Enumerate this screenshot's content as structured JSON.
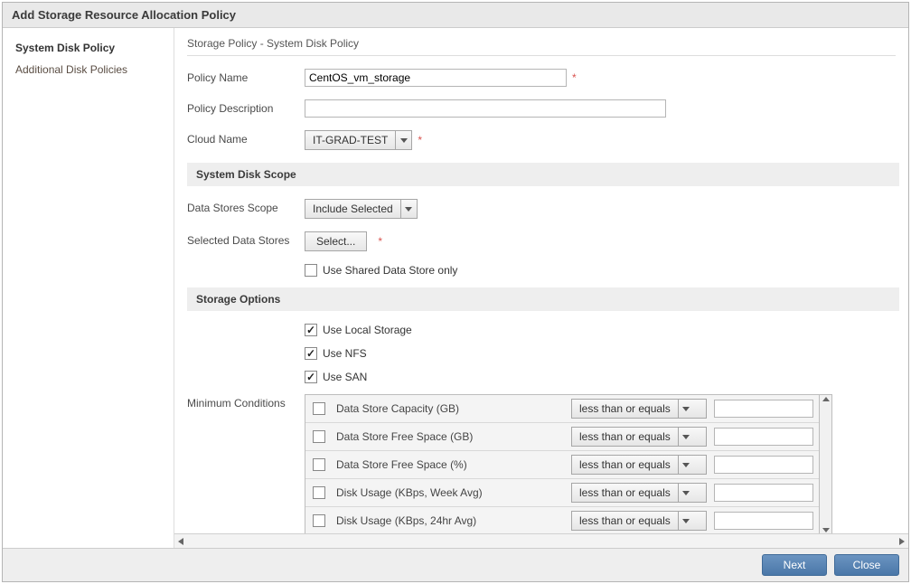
{
  "dialog": {
    "title": "Add Storage Resource Allocation Policy"
  },
  "sidebar": {
    "items": [
      {
        "label": "System Disk Policy",
        "selected": true
      },
      {
        "label": "Additional Disk Policies",
        "selected": false
      }
    ]
  },
  "breadcrumb": "Storage Policy - System Disk Policy",
  "form": {
    "policy_name_label": "Policy Name",
    "policy_name_value": "CentOS_vm_storage",
    "policy_desc_label": "Policy Description",
    "policy_desc_value": "",
    "cloud_name_label": "Cloud Name",
    "cloud_name_value": "IT-GRAD-TEST"
  },
  "section_scope": {
    "header": "System Disk Scope",
    "data_stores_scope_label": "Data Stores Scope",
    "data_stores_scope_value": "Include Selected",
    "selected_data_stores_label": "Selected Data Stores",
    "select_button": "Select...",
    "shared_only_label": "Use Shared Data Store only",
    "shared_only_checked": false
  },
  "section_options": {
    "header": "Storage Options",
    "options": [
      {
        "label": "Use Local Storage",
        "checked": true
      },
      {
        "label": "Use NFS",
        "checked": true
      },
      {
        "label": "Use SAN",
        "checked": true
      }
    ]
  },
  "conditions": {
    "label": "Minimum Conditions",
    "operator_default": "less than or equals",
    "rows": [
      {
        "label": "Data Store Capacity (GB)",
        "checked": false,
        "value": ""
      },
      {
        "label": "Data Store Free Space (GB)",
        "checked": false,
        "value": ""
      },
      {
        "label": "Data Store Free Space (%)",
        "checked": false,
        "value": ""
      },
      {
        "label": "Disk Usage (KBps, Week Avg)",
        "checked": false,
        "value": ""
      },
      {
        "label": "Disk Usage (KBps, 24hr Avg)",
        "checked": false,
        "value": ""
      }
    ]
  },
  "footer": {
    "next": "Next",
    "close": "Close"
  }
}
